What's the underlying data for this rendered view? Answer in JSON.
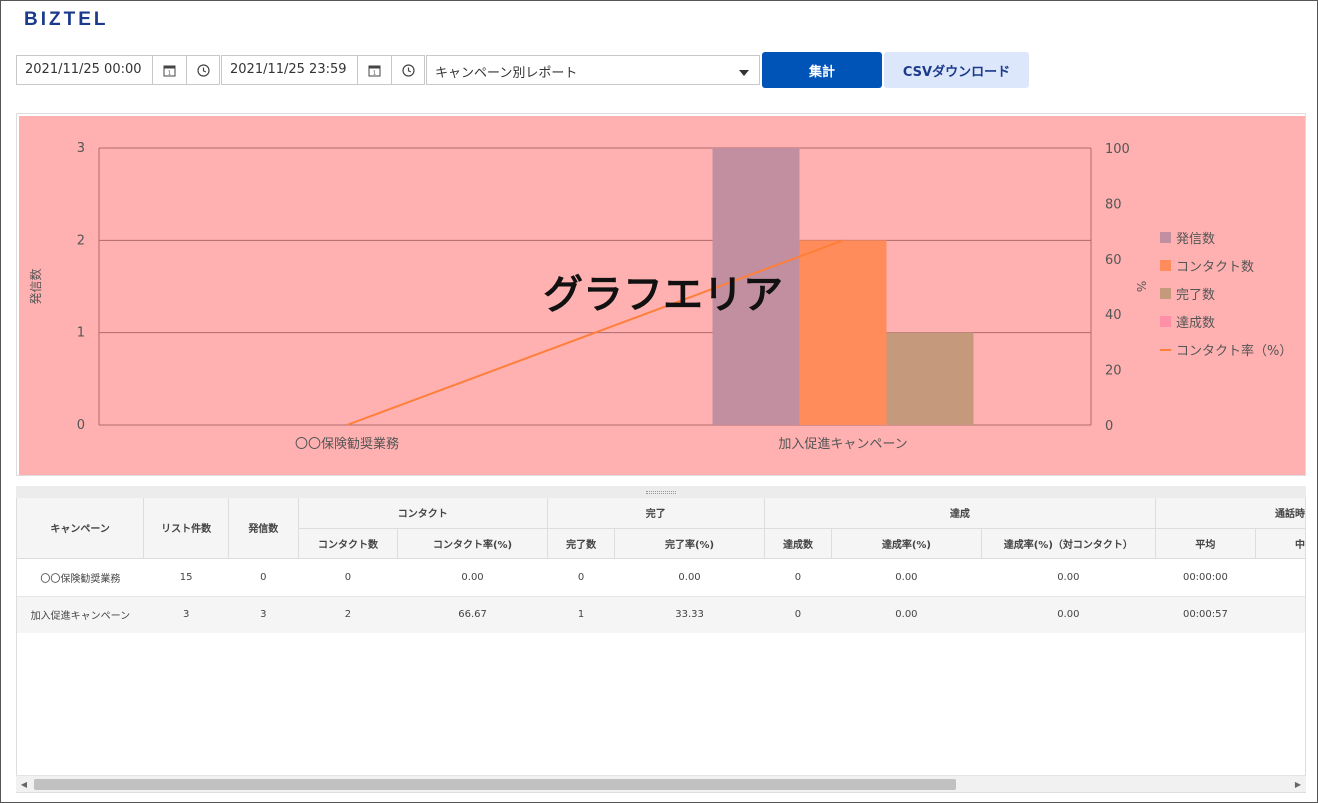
{
  "app": {
    "logo": "BIZTEL"
  },
  "filters": {
    "start_datetime": "2021/11/25 00:00",
    "end_datetime": "2021/11/25 23:59",
    "report_type": "キャンペーン別レポート",
    "aggregate_label": "集計",
    "csv_label": "CSVダウンロード"
  },
  "colors": {
    "primary": "#0054b8",
    "secondary_bg": "#dde7fb",
    "chart_area": "#ffb1b1",
    "series_calls": "#c18fa0",
    "series_contacts": "#ff8c5a",
    "series_completed": "#c59a7c",
    "series_achieved": "#ff8fa6",
    "series_rate": "#ff7f3a"
  },
  "chart_data": {
    "type": "bar",
    "overlay_text": "グラフエリア",
    "categories": [
      "〇〇保険勧奨業務",
      "加入促進キャンペーン"
    ],
    "ylabel": "発信数",
    "y2label": "%",
    "ylim": [
      0,
      3
    ],
    "y2lim": [
      0,
      100
    ],
    "yticks": [
      0,
      1,
      2,
      3
    ],
    "y2ticks": [
      0,
      20,
      40,
      60,
      80,
      100
    ],
    "grid": true,
    "legend_position": "right",
    "series": [
      {
        "name": "発信数",
        "kind": "bar",
        "axis": "left",
        "values": [
          0,
          3
        ]
      },
      {
        "name": "コンタクト数",
        "kind": "bar",
        "axis": "left",
        "values": [
          0,
          2
        ]
      },
      {
        "name": "完了数",
        "kind": "bar",
        "axis": "left",
        "values": [
          0,
          1
        ]
      },
      {
        "name": "達成数",
        "kind": "bar",
        "axis": "left",
        "values": [
          0,
          0
        ]
      },
      {
        "name": "コンタクト率（%）",
        "kind": "line",
        "axis": "right",
        "values": [
          0,
          66.67
        ]
      }
    ]
  },
  "table": {
    "headers": {
      "campaign": "キャンペーン",
      "list_count": "リスト件数",
      "calls": "発信数",
      "contact": "コンタクト",
      "contact_count": "コンタクト数",
      "contact_rate": "コンタクト率(%)",
      "complete": "完了",
      "complete_count": "完了数",
      "complete_rate": "完了率(%)",
      "achieve": "達成",
      "achieve_count": "達成数",
      "achieve_rate": "達成率(%)",
      "achieve_rate_contact": "達成率(%)（対コンタクト）",
      "talk_time": "通話時",
      "average": "平均",
      "cut_col": "中"
    },
    "rows": [
      [
        "〇〇保険勧奨業務",
        "15",
        "0",
        "0",
        "0.00",
        "0",
        "0.00",
        "0",
        "0.00",
        "0.00",
        "00:00:00",
        ""
      ],
      [
        "加入促進キャンペーン",
        "3",
        "3",
        "2",
        "66.67",
        "1",
        "33.33",
        "0",
        "0.00",
        "0.00",
        "00:00:57",
        ""
      ]
    ]
  }
}
